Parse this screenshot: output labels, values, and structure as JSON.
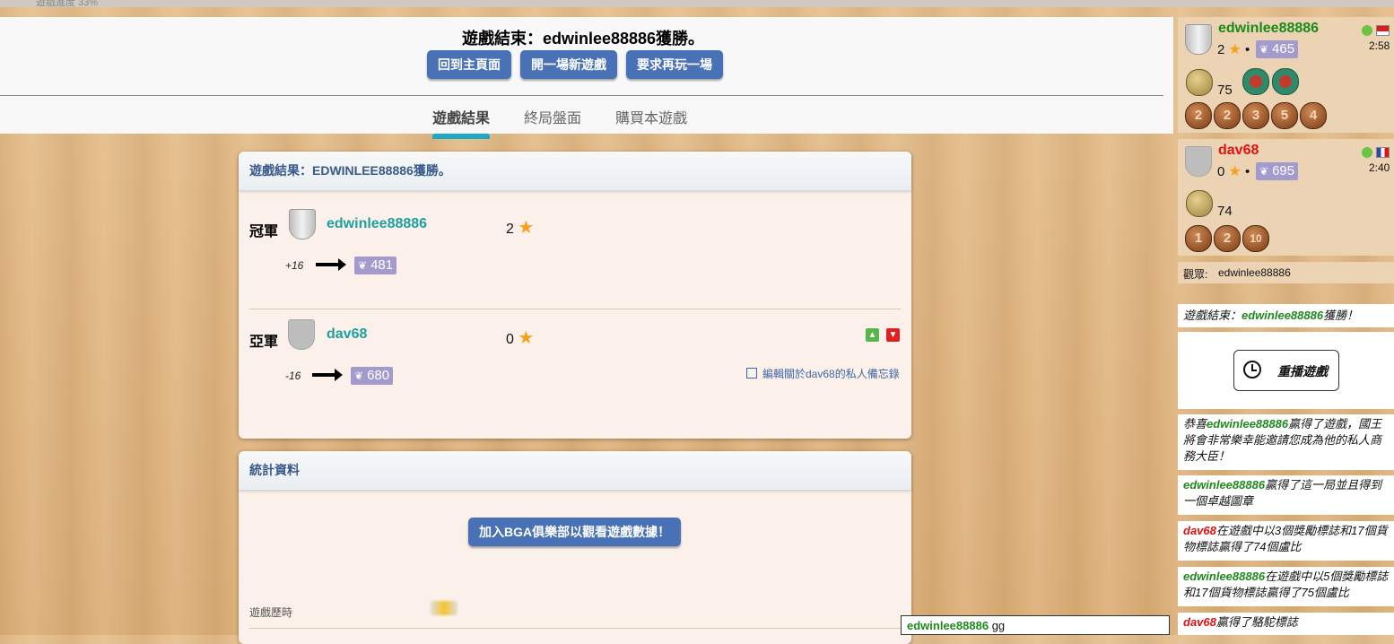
{
  "top_strip_text": "遊戲進度 33%",
  "header": {
    "title": "遊戲結束：edwinlee88886獲勝。",
    "buttons": [
      "回到主頁面",
      "開一場新遊戲",
      "要求再玩一場"
    ],
    "tabs": [
      "遊戲結果",
      "終局盤面",
      "購買本遊戲"
    ],
    "active_tab": 0
  },
  "result_box": {
    "title": "遊戲結果：EDWINLEE88886獲勝。",
    "rows": [
      {
        "rank": "冠軍",
        "name": "edwinlee88886",
        "score": "2",
        "delta": "+16",
        "elo": "481"
      },
      {
        "rank": "亞軍",
        "name": "dav68",
        "score": "0",
        "delta": "-16",
        "elo": "680",
        "note": "編輯關於dav68的私人備忘錄"
      }
    ]
  },
  "stats_box": {
    "title": "統計資料",
    "join_button": "加入BGA俱樂部以觀看遊戲數據！",
    "row_label": "遊戲歷時"
  },
  "sidebar": {
    "players": [
      {
        "name": "edwinlee88886",
        "color": "#1a8a1a",
        "stars": "2",
        "elo": "465",
        "time": "2:58",
        "coins": "75",
        "tokens": [
          "2",
          "2",
          "3",
          "5",
          "4"
        ]
      },
      {
        "name": "dav68",
        "color": "#e01212",
        "stars": "0",
        "elo": "695",
        "time": "2:40",
        "coins": "74",
        "tokens": [
          "1",
          "2",
          "10"
        ]
      }
    ],
    "observers_label": "觀眾:",
    "observers": "edwinlee88886",
    "log": {
      "end_pre": "遊戲結束：",
      "end_name": "edwinlee88886",
      "end_post": "獲勝！",
      "replay_label": "重播遊戲",
      "m1_pre": "恭喜",
      "m1_name": "edwinlee88886",
      "m1_post": "贏得了遊戲，國王將會非常樂幸能邀請您成為他的私人商務大臣！",
      "m2_name": "edwinlee88886",
      "m2_post": "贏得了這一局並且得到一個卓越圖章",
      "m3_name": "dav68",
      "m3_post": "在遊戲中以3個獎勵標誌和17個貨物標誌贏得了74個盧比",
      "m4_name": "edwinlee88886",
      "m4_post": "在遊戲中以5個獎勵標誌和17個貨物標誌贏得了75個盧比",
      "m5_name": "dav68",
      "m5_post": "贏得了駱駝標誌"
    }
  },
  "chat": {
    "name": "edwinlee88886",
    "text": "gg"
  }
}
